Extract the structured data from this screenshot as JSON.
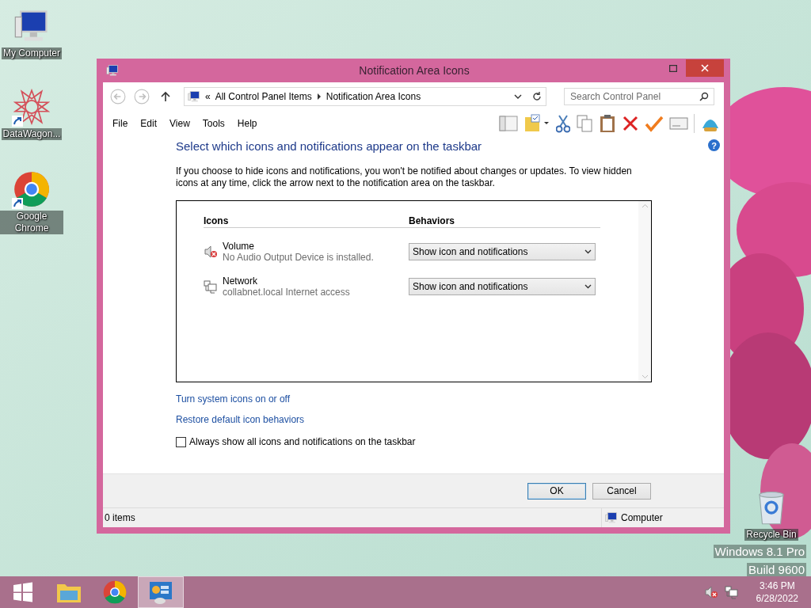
{
  "desktop_icons": [
    {
      "label": "My Computer",
      "kind": "computer",
      "shortcut": false
    },
    {
      "label": "DataWagon...",
      "kind": "star",
      "shortcut": true
    },
    {
      "label": "Google Chrome",
      "kind": "chrome",
      "shortcut": true
    },
    {
      "label": "Recycle Bin",
      "kind": "bin",
      "shortcut": false
    }
  ],
  "watermark": [
    "Windows 8.1 Pro",
    "Build 9600"
  ],
  "window": {
    "title": "Notification Area Icons",
    "nav": [
      {
        "kind": "back",
        "disabled": true
      },
      {
        "kind": "forward",
        "disabled": true
      },
      {
        "kind": "up",
        "disabled": false
      }
    ],
    "address": {
      "overflow": "«",
      "crumbs": [
        "All Control Panel Items",
        "Notification Area Icons"
      ]
    },
    "search": {
      "placeholder": "Search Control Panel"
    },
    "help": "?",
    "menu": [
      "File",
      "Edit",
      "View",
      "Tools",
      "Help"
    ],
    "heading": "Select which icons and notifications appear on the taskbar",
    "description": "If you choose to hide icons and notifications, you won't be notified about changes or updates. To view hidden icons at any time, click the arrow next to the notification area on the taskbar.",
    "table": {
      "columns": [
        "Icons",
        "Behaviors"
      ],
      "rows": [
        {
          "kind": "volume",
          "name": "Volume",
          "detail": "No Audio Output Device is installed.",
          "behavior": "Show icon and notifications"
        },
        {
          "kind": "network",
          "name": "Network",
          "detail": "collabnet.local Internet access",
          "behavior": "Show icon and notifications"
        }
      ]
    },
    "links": [
      "Turn system icons on or off",
      "Restore default icon behaviors"
    ],
    "checkbox": {
      "label": "Always show all icons and notifications on the taskbar",
      "checked": false
    },
    "buttons": [
      {
        "label": "OK",
        "default": true
      },
      {
        "label": "Cancel",
        "default": false
      }
    ],
    "status_bar": {
      "items": "0 items",
      "location": "Computer"
    }
  },
  "taskbar": {
    "apps": [
      {
        "kind": "start",
        "selected": false
      },
      {
        "kind": "explorer",
        "selected": false
      },
      {
        "kind": "chrome",
        "selected": false
      },
      {
        "kind": "control-panel",
        "selected": true
      }
    ],
    "time": "3:46 PM",
    "date": "6/28/2022"
  }
}
